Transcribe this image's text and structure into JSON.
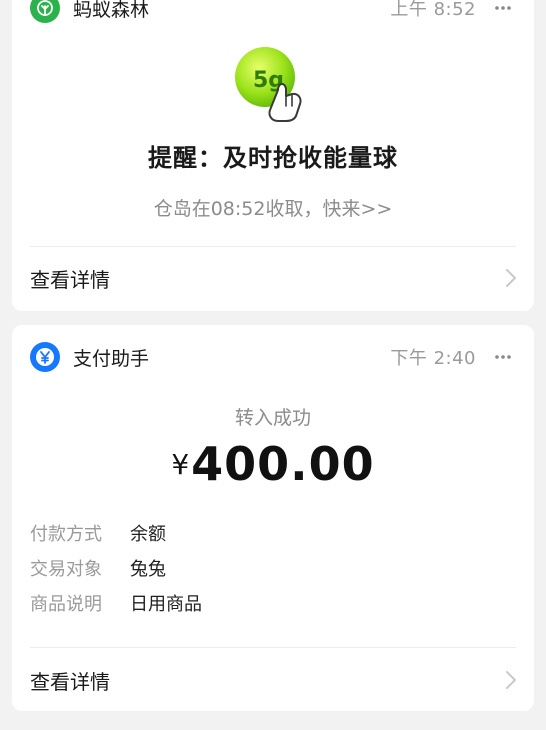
{
  "reminder_card": {
    "app_name": "蚂蚁森林",
    "time": "上午 8:52",
    "title": "提醒：及时抢收能量球",
    "subtitle": "仓岛在08:52收取，快来>>",
    "badge_text": "5g",
    "detail_label": "查看详情",
    "icon": "leaf-icon",
    "accent_color": "#2bb24c"
  },
  "payment_card": {
    "app_name": "支付助手",
    "time": "下午 2:40",
    "status": "转入成功",
    "currency": "¥",
    "amount": "400.00",
    "fields": [
      {
        "key": "付款方式",
        "value": "余额"
      },
      {
        "key": "交易对象",
        "value": "兔兔"
      },
      {
        "key": "商品说明",
        "value": "日用商品"
      }
    ],
    "detail_label": "查看详情",
    "icon": "yuan-icon",
    "accent_color": "#1677ff"
  }
}
